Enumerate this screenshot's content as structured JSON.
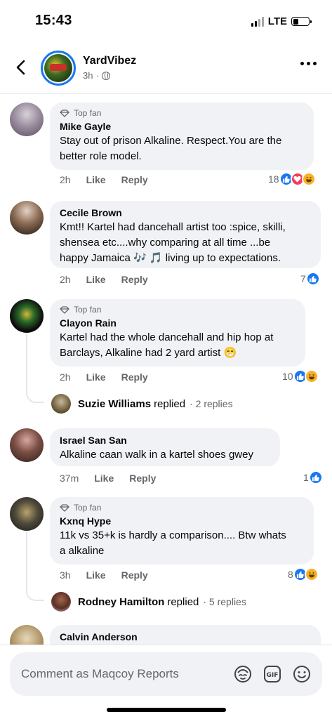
{
  "status_bar": {
    "time": "15:43",
    "network": "LTE",
    "battery_level": 0.35
  },
  "header": {
    "page_name": "YardVibez",
    "time_ago": "3h",
    "visibility_icon": "globe-icon",
    "back_icon": "chevron-left-icon",
    "more_icon": "more-horizontal-icon"
  },
  "comments": [
    {
      "top_fan": "Top fan",
      "author": "Mike Gayle",
      "lines": [
        "Stay out of prison Alkaline. Respect.You are the",
        "better role model."
      ],
      "time": "2h",
      "like": "Like",
      "reply": "Reply",
      "reaction_count": "18",
      "reactions": [
        "like",
        "love",
        "haha"
      ]
    },
    {
      "author": "Cecile Brown",
      "lines": [
        "Kmt!! Kartel had dancehall artist too :spice, skilli,",
        "shensea etc....why comparing at all time ...be",
        "happy Jamaica 🎶 🎵  living up to expectations."
      ],
      "time": "2h",
      "like": "Like",
      "reply": "Reply",
      "reaction_count": "7",
      "reactions": [
        "like"
      ]
    },
    {
      "top_fan": "Top fan",
      "author": "Clayon Rain",
      "lines": [
        "Kartel had the whole dancehall and hip hop at",
        "Barclays, Alkaline had 2 yard artist 😁"
      ],
      "time": "2h",
      "like": "Like",
      "reply": "Reply",
      "reaction_count": "10",
      "reactions": [
        "like",
        "haha"
      ],
      "replies": {
        "name": "Suzie Williams",
        "word": "replied",
        "count": "· 2 replies"
      }
    },
    {
      "author": "Israel San San",
      "lines": [
        "Alkaline caan walk in a kartel shoes gwey"
      ],
      "time": "37m",
      "like": "Like",
      "reply": "Reply",
      "reaction_count": "1",
      "reactions": [
        "like"
      ]
    },
    {
      "top_fan": "Top fan",
      "author": "Kxnq Hype",
      "lines": [
        "11k vs 35+k is hardly a comparison.... Btw whats",
        "a alkaline"
      ],
      "time": "3h",
      "like": "Like",
      "reply": "Reply",
      "reaction_count": "8",
      "reactions": [
        "like",
        "haha"
      ],
      "replies": {
        "name": "Rodney Hamilton",
        "word": "replied",
        "count": "· 5 replies"
      }
    },
    {
      "author": "Calvin Anderson"
    }
  ],
  "composer": {
    "placeholder": "Comment as Maqcoy Reports",
    "icons": [
      "avatar-sticker-icon",
      "gif-icon",
      "emoji-icon"
    ],
    "gif_label": "GIF"
  },
  "colors": {
    "accent": "#1877f2",
    "love": "#f33e58",
    "haha": "#f7b125",
    "bubble": "#f0f2f5",
    "muted": "#65676b"
  }
}
